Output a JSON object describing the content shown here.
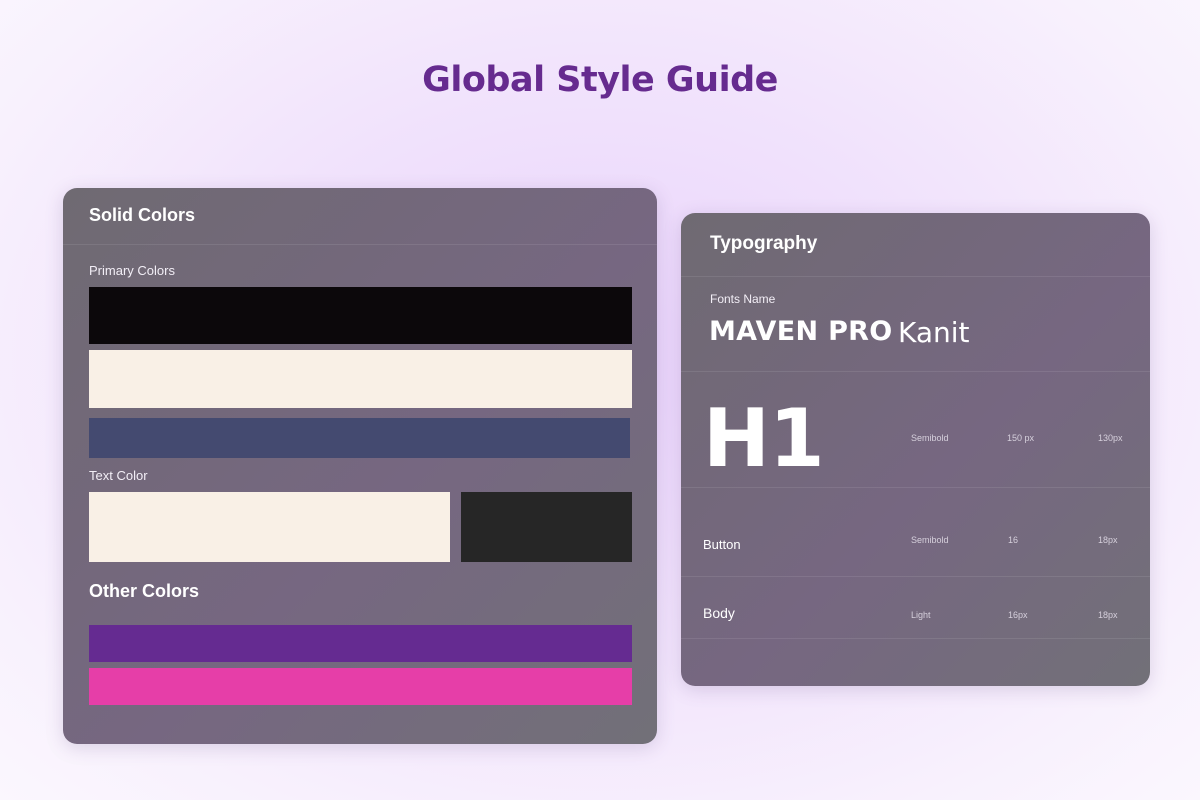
{
  "page_title": "Global Style Guide",
  "colors": {
    "title": "#662b8f",
    "primary": [
      "#0c080b",
      "#f9f0e6",
      "#444a70"
    ],
    "text": [
      "#f9f0e6",
      "#262626"
    ],
    "other": [
      "#652b91",
      "#e63ea8"
    ]
  },
  "solid_colors": {
    "title": "Solid Colors",
    "primary_label": "Primary Colors",
    "text_label": "Text Color",
    "other_title": "Other Colors"
  },
  "typography": {
    "title": "Typography",
    "fonts_label": "Fonts Name",
    "fonts": [
      "MAVEN PRO",
      "Kanit"
    ],
    "rows": [
      {
        "name": "H1",
        "weight": "Semibold",
        "size": "150 px",
        "line_height": "130px"
      },
      {
        "name": "Button",
        "weight": "Semibold",
        "size": "16",
        "line_height": "18px"
      },
      {
        "name": "Body",
        "weight": "Light",
        "size": "16px",
        "line_height": "18px"
      }
    ]
  }
}
